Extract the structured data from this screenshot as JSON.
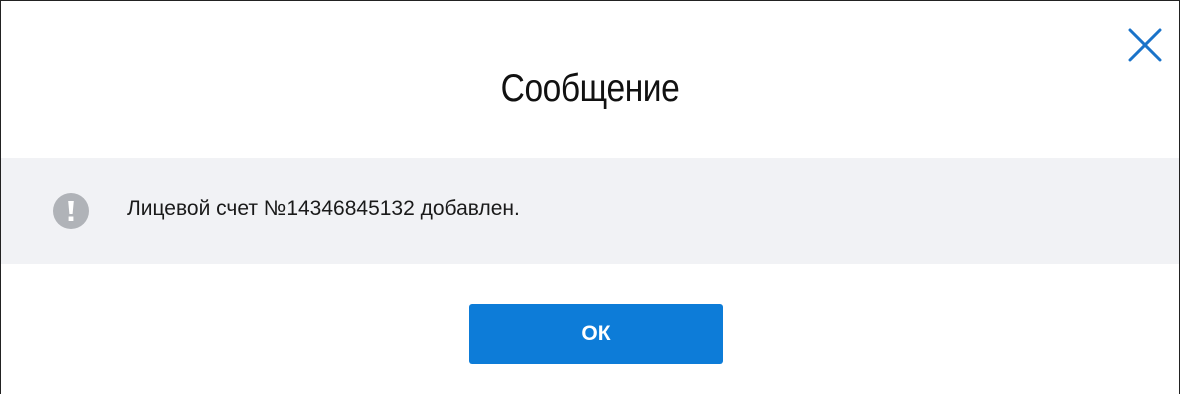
{
  "dialog": {
    "title": "Сообщение",
    "message": "Лицевой счет №14346845132 добавлен.",
    "ok_label": "ОК",
    "close_icon": "close-icon",
    "message_icon": "exclamation-icon"
  },
  "colors": {
    "accent": "#0d7cd8",
    "message_background": "#f1f2f5",
    "icon_gray": "#b0b3b8",
    "close_icon": "#1a73c9"
  }
}
